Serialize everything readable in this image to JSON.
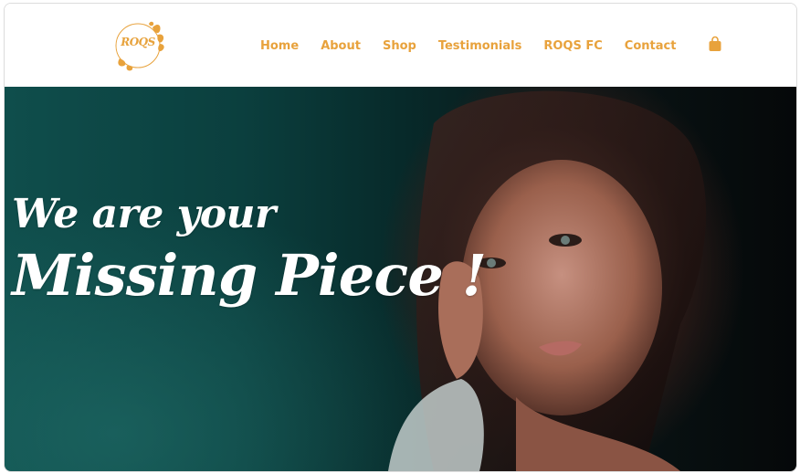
{
  "header": {
    "logo_text": "ROQS",
    "nav": [
      "Home",
      "About",
      "Shop",
      "Testimonials",
      "ROQS FC",
      "Contact"
    ]
  },
  "hero": {
    "line1": "We are your",
    "line2": "Missing Piece !"
  },
  "colors": {
    "accent": "#e8a23c",
    "hero_teal": "#0f4e4c",
    "text_light": "#ffffff"
  },
  "icons": {
    "cart": "shopping-bag-icon",
    "logo": "leaf-wreath-logo"
  }
}
